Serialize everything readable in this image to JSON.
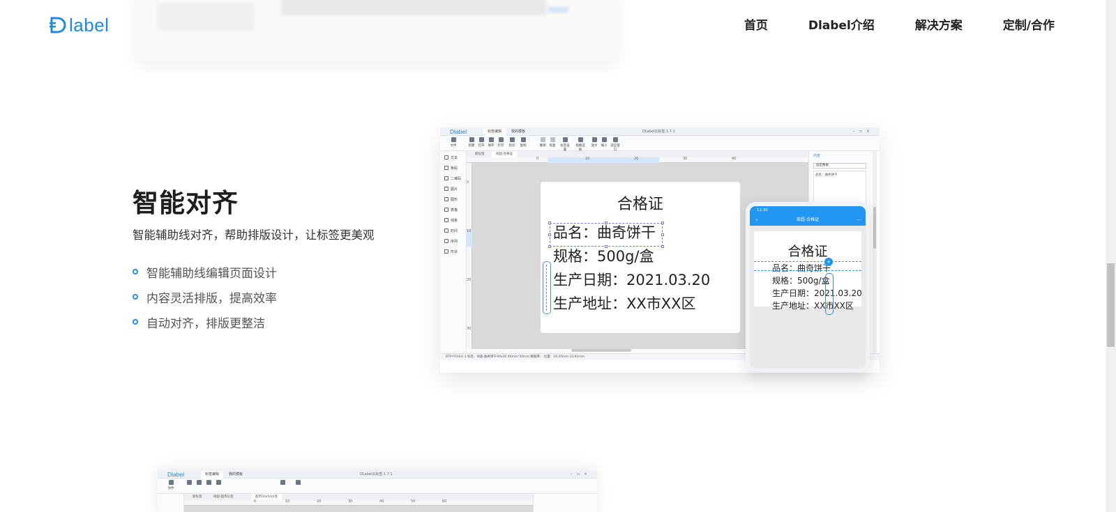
{
  "header": {
    "logo_text": "label",
    "nav": [
      "首页",
      "Dlabel介绍",
      "解决方案",
      "定制/合作"
    ]
  },
  "feature": {
    "title": "智能对齐",
    "subtitle": "智能辅助线对齐，帮助排版设计，让标签更美观",
    "bullets": [
      "智能辅助线编辑页面设计",
      "内容灵活排版，提高效率",
      "自动对齐，排版更整洁"
    ]
  },
  "app": {
    "logo": "Dlabel",
    "tabs": [
      "标签编辑",
      "我的模板"
    ],
    "window_title": "DLabel云标签 1.7.1",
    "toolbar": [
      "新建",
      "打开",
      "保存",
      "打印",
      "剪切",
      "复制",
      "粘贴",
      "撤销",
      "恢复",
      "标签设置",
      "视图选择",
      "放大",
      "缩小",
      "适应窗口"
    ],
    "left_tools": [
      "文本",
      "条码",
      "二维码",
      "图片",
      "图形",
      "表格",
      "线条",
      "时间",
      "序列",
      "形状"
    ],
    "doc_tabs": [
      "新标签",
      "商超-合格证"
    ],
    "ruler_top": [
      "0",
      "10",
      "20",
      "30",
      "40"
    ],
    "ruler_left": [
      "0",
      "10",
      "20",
      "30"
    ],
    "right_panel_header": "内容",
    "right_select": "固定数据",
    "right_box_text": "品名：曲奇饼干",
    "statusbar": "BTP-P33(U) 1    标签：商超-曲奇饼干40x30  40mm*30mm    数据库：    位置：16.05mm 10.81mm"
  },
  "label": {
    "title": "合格证",
    "rows": [
      "品名：曲奇饼干",
      "规格：500g/盒",
      "生产日期：2021.03.20",
      "生产地址：XX市XX区"
    ]
  },
  "phone": {
    "time": "11:30",
    "nav_title": "商超-合格证",
    "label_title": "合格证",
    "rows": [
      "品名：曲奇饼干",
      "规格：500g/盒",
      "生产日期：2021.03.20",
      "生产地址：XX市XX区"
    ]
  },
  "bottom_app": {
    "logo": "Dlabel",
    "tabs": [
      "标签编辑",
      "我的模板"
    ],
    "window_title": "DLabel云标签 1.7.1",
    "doc_tabs": [
      "新标签",
      "商超-超市价签",
      "超市50x50价签"
    ],
    "ruler": [
      "0",
      "10",
      "20",
      "30",
      "40",
      "50",
      "60"
    ]
  },
  "colors": {
    "brand": "#1e88e5",
    "accent_blue": "#2196f3",
    "bullet": "#2a8be6"
  }
}
